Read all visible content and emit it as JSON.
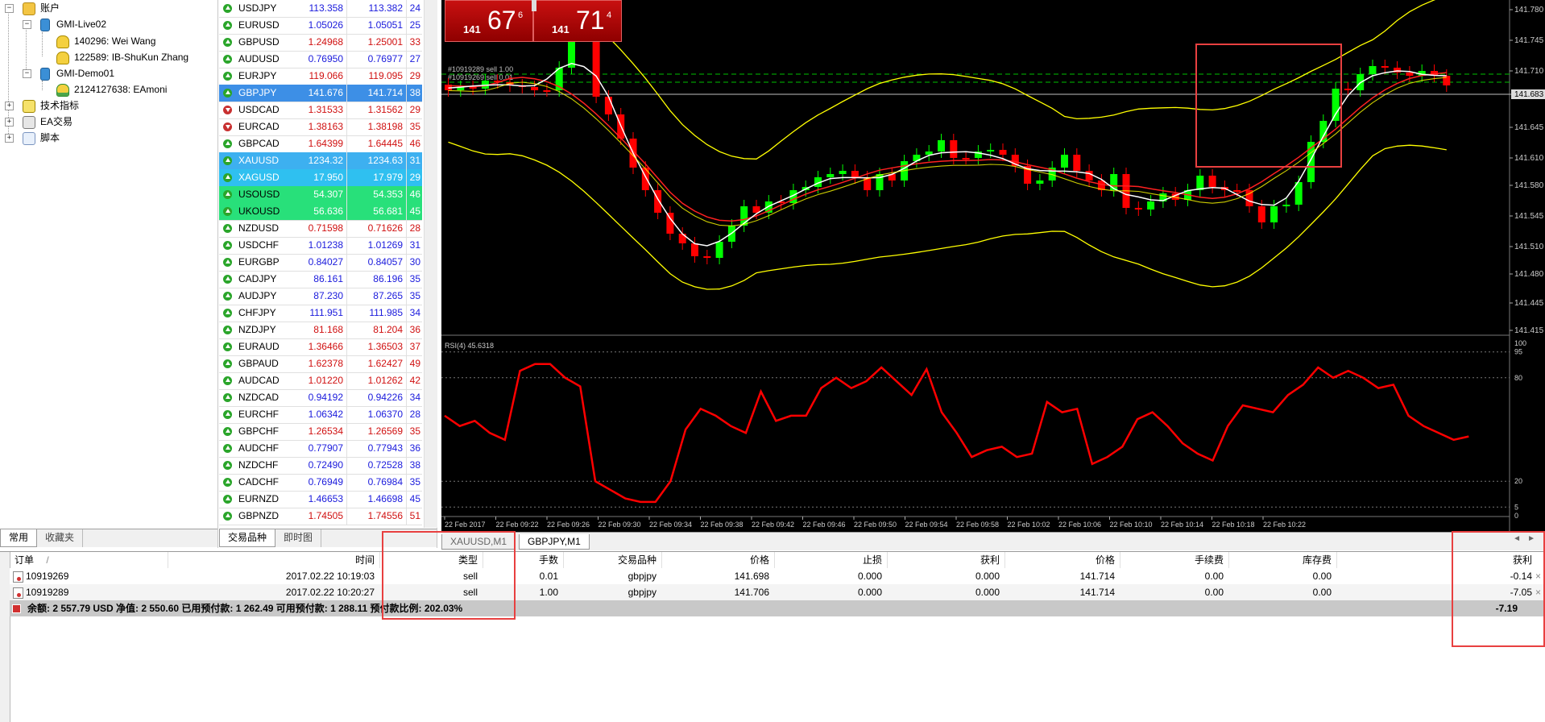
{
  "navigator": {
    "root_label": "账户",
    "accounts": [
      {
        "server": "GMI-Live02",
        "users": [
          "140296: Wei Wang",
          "122589: IB-ShuKun Zhang"
        ]
      },
      {
        "server": "GMI-Demo01",
        "users": [
          "2124127638: EAmoni"
        ]
      }
    ],
    "folders": [
      "技术指标",
      "EA交易",
      "脚本"
    ],
    "tabs": [
      "常用",
      "收藏夹"
    ]
  },
  "market_watch": {
    "rows": [
      {
        "sym": "USDJPY",
        "bid": "113.358",
        "ask": "113.382",
        "spread": "24",
        "dir": "up"
      },
      {
        "sym": "EURUSD",
        "bid": "1.05026",
        "ask": "1.05051",
        "spread": "25",
        "dir": "up"
      },
      {
        "sym": "GBPUSD",
        "bid": "1.24968",
        "ask": "1.25001",
        "spread": "33",
        "dir": "up",
        "red": true
      },
      {
        "sym": "AUDUSD",
        "bid": "0.76950",
        "ask": "0.76977",
        "spread": "27",
        "dir": "up"
      },
      {
        "sym": "EURJPY",
        "bid": "119.066",
        "ask": "119.095",
        "spread": "29",
        "dir": "up",
        "red": true
      },
      {
        "sym": "GBPJPY",
        "bid": "141.676",
        "ask": "141.714",
        "spread": "38",
        "dir": "up",
        "hl": "#3d8fe6"
      },
      {
        "sym": "USDCAD",
        "bid": "1.31533",
        "ask": "1.31562",
        "spread": "29",
        "dir": "down",
        "red": true
      },
      {
        "sym": "EURCAD",
        "bid": "1.38163",
        "ask": "1.38198",
        "spread": "35",
        "dir": "down",
        "red": true
      },
      {
        "sym": "GBPCAD",
        "bid": "1.64399",
        "ask": "1.64445",
        "spread": "46",
        "dir": "up",
        "red": true
      },
      {
        "sym": "XAUUSD",
        "bid": "1234.32",
        "ask": "1234.63",
        "spread": "31",
        "dir": "up",
        "hl": "#3db0f0"
      },
      {
        "sym": "XAGUSD",
        "bid": "17.950",
        "ask": "17.979",
        "spread": "29",
        "dir": "up",
        "hl": "#2fc0f0"
      },
      {
        "sym": "USOUSD",
        "bid": "54.307",
        "ask": "54.353",
        "spread": "46",
        "dir": "up",
        "hl": "#28e07a"
      },
      {
        "sym": "UKOUSD",
        "bid": "56.636",
        "ask": "56.681",
        "spread": "45",
        "dir": "up",
        "hl": "#28e07a"
      },
      {
        "sym": "NZDUSD",
        "bid": "0.71598",
        "ask": "0.71626",
        "spread": "28",
        "dir": "up",
        "red": true
      },
      {
        "sym": "USDCHF",
        "bid": "1.01238",
        "ask": "1.01269",
        "spread": "31",
        "dir": "up"
      },
      {
        "sym": "EURGBP",
        "bid": "0.84027",
        "ask": "0.84057",
        "spread": "30",
        "dir": "up"
      },
      {
        "sym": "CADJPY",
        "bid": "86.161",
        "ask": "86.196",
        "spread": "35",
        "dir": "up"
      },
      {
        "sym": "AUDJPY",
        "bid": "87.230",
        "ask": "87.265",
        "spread": "35",
        "dir": "up"
      },
      {
        "sym": "CHFJPY",
        "bid": "111.951",
        "ask": "111.985",
        "spread": "34",
        "dir": "up"
      },
      {
        "sym": "NZDJPY",
        "bid": "81.168",
        "ask": "81.204",
        "spread": "36",
        "dir": "up",
        "red": true
      },
      {
        "sym": "EURAUD",
        "bid": "1.36466",
        "ask": "1.36503",
        "spread": "37",
        "dir": "up",
        "red": true
      },
      {
        "sym": "GBPAUD",
        "bid": "1.62378",
        "ask": "1.62427",
        "spread": "49",
        "dir": "up",
        "red": true
      },
      {
        "sym": "AUDCAD",
        "bid": "1.01220",
        "ask": "1.01262",
        "spread": "42",
        "dir": "up",
        "red": true
      },
      {
        "sym": "NZDCAD",
        "bid": "0.94192",
        "ask": "0.94226",
        "spread": "34",
        "dir": "up"
      },
      {
        "sym": "EURCHF",
        "bid": "1.06342",
        "ask": "1.06370",
        "spread": "28",
        "dir": "up"
      },
      {
        "sym": "GBPCHF",
        "bid": "1.26534",
        "ask": "1.26569",
        "spread": "35",
        "dir": "up",
        "red": true
      },
      {
        "sym": "AUDCHF",
        "bid": "0.77907",
        "ask": "0.77943",
        "spread": "36",
        "dir": "up"
      },
      {
        "sym": "NZDCHF",
        "bid": "0.72490",
        "ask": "0.72528",
        "spread": "38",
        "dir": "up"
      },
      {
        "sym": "CADCHF",
        "bid": "0.76949",
        "ask": "0.76984",
        "spread": "35",
        "dir": "up"
      },
      {
        "sym": "EURNZD",
        "bid": "1.46653",
        "ask": "1.46698",
        "spread": "45",
        "dir": "up"
      },
      {
        "sym": "GBPNZD",
        "bid": "1.74505",
        "ask": "1.74556",
        "spread": "51",
        "dir": "up",
        "red": true
      }
    ],
    "tabs": [
      "交易品种",
      "即时图"
    ]
  },
  "one_click": {
    "sell_small": "141",
    "sell_big": "67",
    "sell_sup": "6",
    "buy_small": "141",
    "buy_big": "71",
    "buy_sup": "4"
  },
  "chart": {
    "price_axis": [
      "141.780",
      "141.745",
      "141.710",
      "141.683",
      "141.645",
      "141.610",
      "141.580",
      "141.545",
      "141.510",
      "141.480",
      "141.445",
      "141.415"
    ],
    "current_price": "141.683",
    "order_labels": [
      "#10919289 sell 1.00",
      "#10919269 sell 0.01"
    ],
    "rsi_label": "RSI(4) 45.6318",
    "rsi_axis": [
      "100",
      "95",
      "80",
      "20",
      "5",
      "0"
    ],
    "time_axis": [
      "22 Feb 2017",
      "22 Feb 09:22",
      "22 Feb 09:26",
      "22 Feb 09:30",
      "22 Feb 09:34",
      "22 Feb 09:38",
      "22 Feb 09:42",
      "22 Feb 09:46",
      "22 Feb 09:50",
      "22 Feb 09:54",
      "22 Feb 09:58",
      "22 Feb 10:02",
      "22 Feb 10:06",
      "22 Feb 10:10",
      "22 Feb 10:14",
      "22 Feb 10:18",
      "22 Feb 10:22"
    ],
    "tabs": [
      "XAUUSD,M1",
      "GBPJPY,M1"
    ],
    "colors": {
      "bull": "#00ff00",
      "bear": "#ff0000",
      "ma_fast": "#ffffff",
      "ma_slow": "#ff2020",
      "bands": "#ffff00",
      "rsi": "#ff0000"
    }
  },
  "terminal": {
    "headers": {
      "order": "订单",
      "sort": "/",
      "time": "时间",
      "type": "类型",
      "lots": "手数",
      "symbol": "交易品种",
      "price": "价格",
      "sl": "止损",
      "tp": "获利",
      "cur_price": "价格",
      "commission": "手续费",
      "swap": "库存费",
      "profit": "获利"
    },
    "rows": [
      {
        "order": "10919269",
        "time": "2017.02.22 10:19:03",
        "type": "sell",
        "lots": "0.01",
        "symbol": "gbpjpy",
        "price": "141.698",
        "sl": "0.000",
        "tp": "0.000",
        "cur_price": "141.714",
        "commission": "0.00",
        "swap": "0.00",
        "profit": "-0.14"
      },
      {
        "order": "10919289",
        "time": "2017.02.22 10:20:27",
        "type": "sell",
        "lots": "1.00",
        "symbol": "gbpjpy",
        "price": "141.706",
        "sl": "0.000",
        "tp": "0.000",
        "cur_price": "141.714",
        "commission": "0.00",
        "swap": "0.00",
        "profit": "-7.05"
      }
    ],
    "summary": "余额: 2 557.79 USD  净值: 2 550.60  已用预付款: 1 262.49  可用预付款: 1 288.11  预付款比例: 202.03%",
    "summary_profit": "-7.19"
  }
}
